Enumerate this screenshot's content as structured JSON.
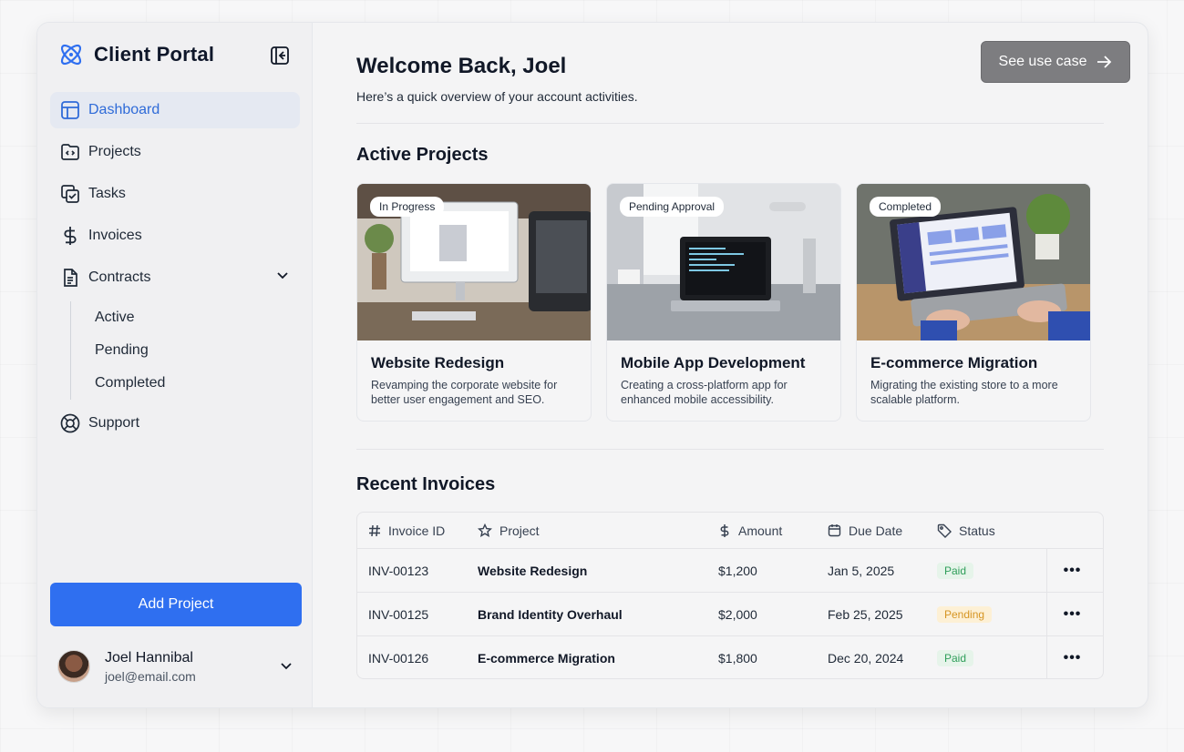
{
  "brand": {
    "title": "Client Portal"
  },
  "sidebar": {
    "items": [
      {
        "label": "Dashboard",
        "icon": "layout-icon"
      },
      {
        "label": "Projects",
        "icon": "folder-code-icon"
      },
      {
        "label": "Tasks",
        "icon": "tasks-icon"
      },
      {
        "label": "Invoices",
        "icon": "dollar-icon"
      },
      {
        "label": "Contracts",
        "icon": "document-icon"
      },
      {
        "label": "Support",
        "icon": "lifebuoy-icon"
      }
    ],
    "contracts_sub": [
      "Active",
      "Pending",
      "Completed"
    ],
    "add_button": "Add Project",
    "user": {
      "name": "Joel Hannibal",
      "email": "joel@email.com"
    }
  },
  "header": {
    "welcome": "Welcome Back, Joel",
    "subtitle": "Here’s a quick overview of your account activities.",
    "usecase_button": "See use case"
  },
  "projects": {
    "title": "Active Projects",
    "cards": [
      {
        "badge": "In Progress",
        "title": "Website Redesign",
        "desc": "Revamping the corporate website for better user engagement and SEO."
      },
      {
        "badge": "Pending Approval",
        "title": "Mobile App Development",
        "desc": "Creating a cross-platform app for enhanced mobile accessibility."
      },
      {
        "badge": "Completed",
        "title": "E-commerce Migration",
        "desc": "Migrating the existing store to a more scalable platform."
      }
    ]
  },
  "invoices": {
    "title": "Recent Invoices",
    "headers": [
      "Invoice ID",
      "Project",
      "Amount",
      "Due Date",
      "Status"
    ],
    "rows": [
      {
        "id": "INV-00123",
        "project": "Website Redesign",
        "amount": "$1,200",
        "due": "Jan 5, 2025",
        "status": "Paid"
      },
      {
        "id": "INV-00125",
        "project": "Brand Identity Overhaul",
        "amount": "$2,000",
        "due": "Feb 25, 2025",
        "status": "Pending"
      },
      {
        "id": "INV-00126",
        "project": "E-commerce Migration",
        "amount": "$1,800",
        "due": "Dec 20, 2024",
        "status": "Paid"
      }
    ]
  },
  "colors": {
    "accent": "#2f6ff0",
    "active_nav_text": "#2f6bd8",
    "paid": "#2f9e5a",
    "pending": "#d69523"
  }
}
